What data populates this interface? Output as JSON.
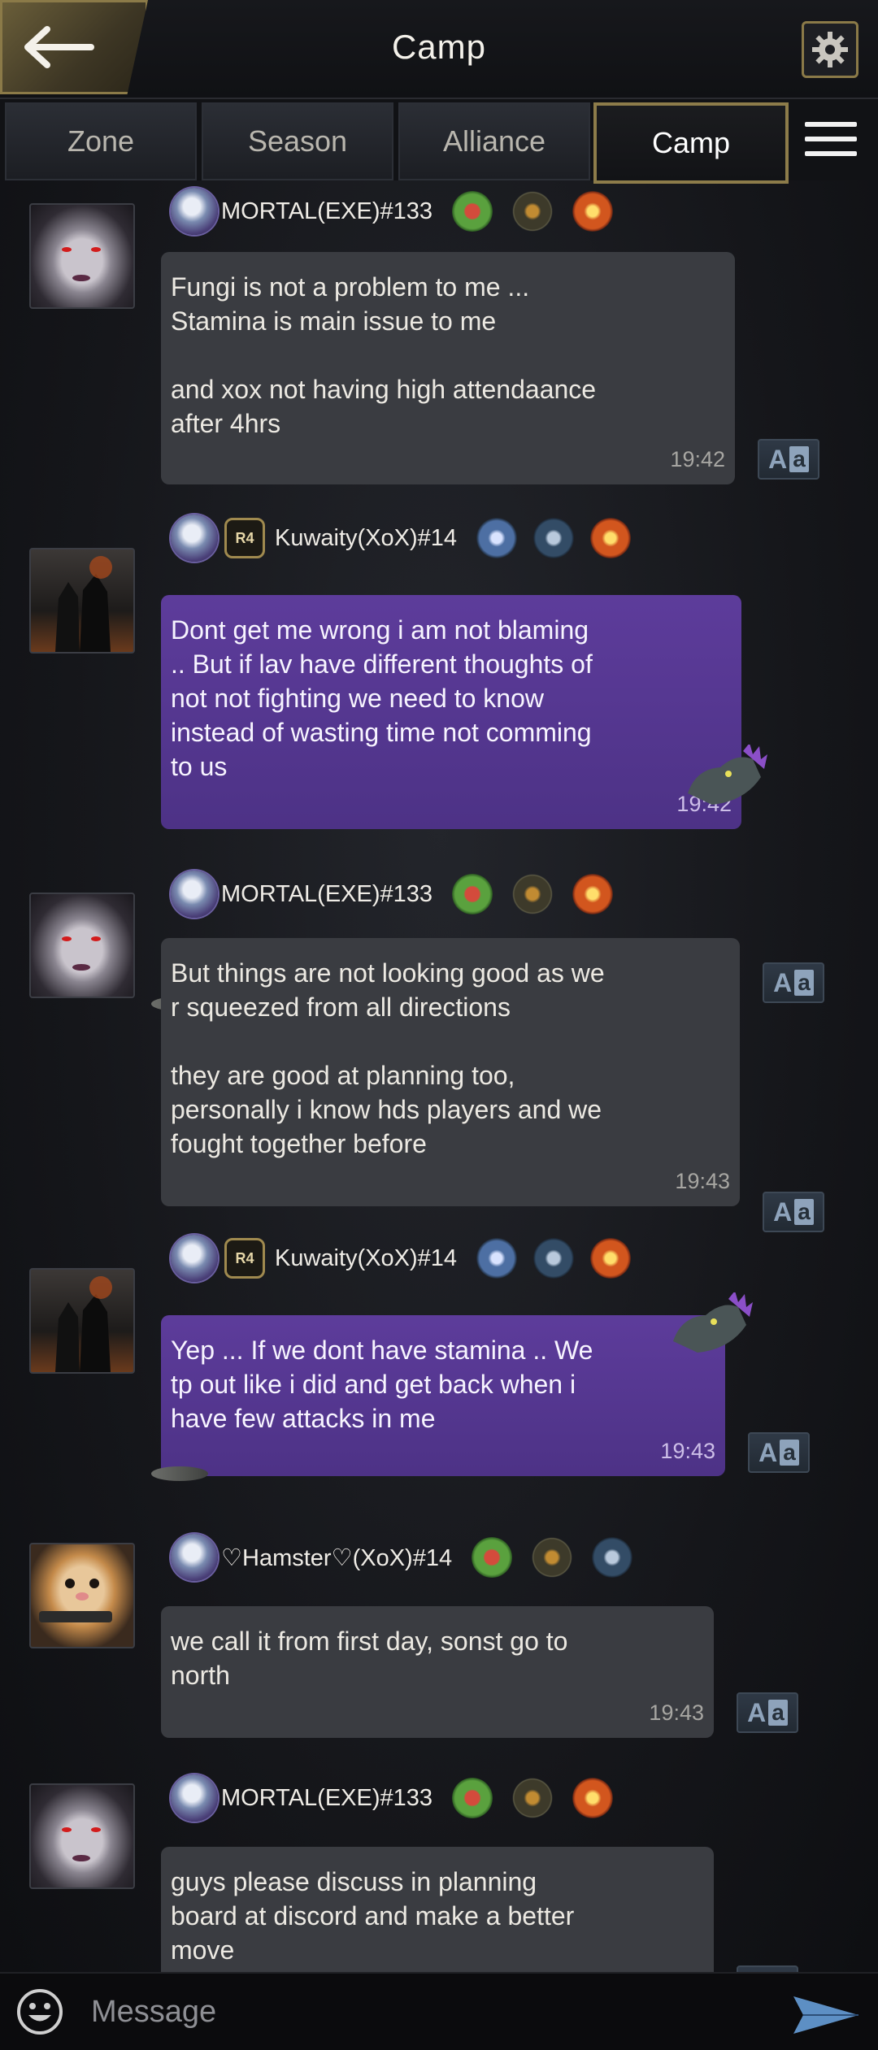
{
  "header": {
    "back_icon": "arrow-left-icon",
    "title": "Camp",
    "settings_icon": "gear-icon"
  },
  "tabs": [
    {
      "label": "Zone",
      "active": false
    },
    {
      "label": "Season",
      "active": false
    },
    {
      "label": "Alliance",
      "active": false
    },
    {
      "label": "Camp",
      "active": true
    }
  ],
  "menu_icon": "list-menu-icon",
  "messages": [
    {
      "sender": "MORTAL(EXE)#133",
      "rank": "",
      "style": "grey",
      "text": "Fungi is not a problem to me ...\nStamina is main issue to me\n\nand xox not having high attendaance\nafter 4hrs",
      "time": "19:42"
    },
    {
      "sender": "Kuwaity(XoX)#14",
      "rank": "R4",
      "style": "purple",
      "text": "Dont get me wrong i am not blaming\n.. But if lav have different thoughts of\nnot not fighting we need to know\ninstead of wasting time not comming\nto us",
      "time": "19:42"
    },
    {
      "sender": "MORTAL(EXE)#133",
      "rank": "",
      "style": "grey",
      "text": "But things are not looking good as we\n r squeezed from all directions\n\nthey are good at planning too,\npersonally i know hds players and we\nfought together before",
      "time": "19:43"
    },
    {
      "sender": "Kuwaity(XoX)#14",
      "rank": "R4",
      "style": "purple",
      "text": "Yep ... If we dont have stamina .. We\ntp out like i did and get back when i\nhave few attacks in me",
      "time": "19:43"
    },
    {
      "sender": "♡Hamster♡(XoX)#14",
      "rank": "",
      "style": "grey",
      "text": "we call it from first day, sonst go to\nnorth",
      "time": "19:43"
    },
    {
      "sender": "MORTAL(EXE)#133",
      "rank": "",
      "style": "grey",
      "text": "guys please discuss in planning\nboard at discord and make a better\nmove",
      "time": ""
    }
  ],
  "translate_label": {
    "big": "A",
    "small": "a"
  },
  "composer": {
    "emoji_icon": "smiley-icon",
    "placeholder": "Message",
    "send_icon": "send-arrow-icon"
  }
}
